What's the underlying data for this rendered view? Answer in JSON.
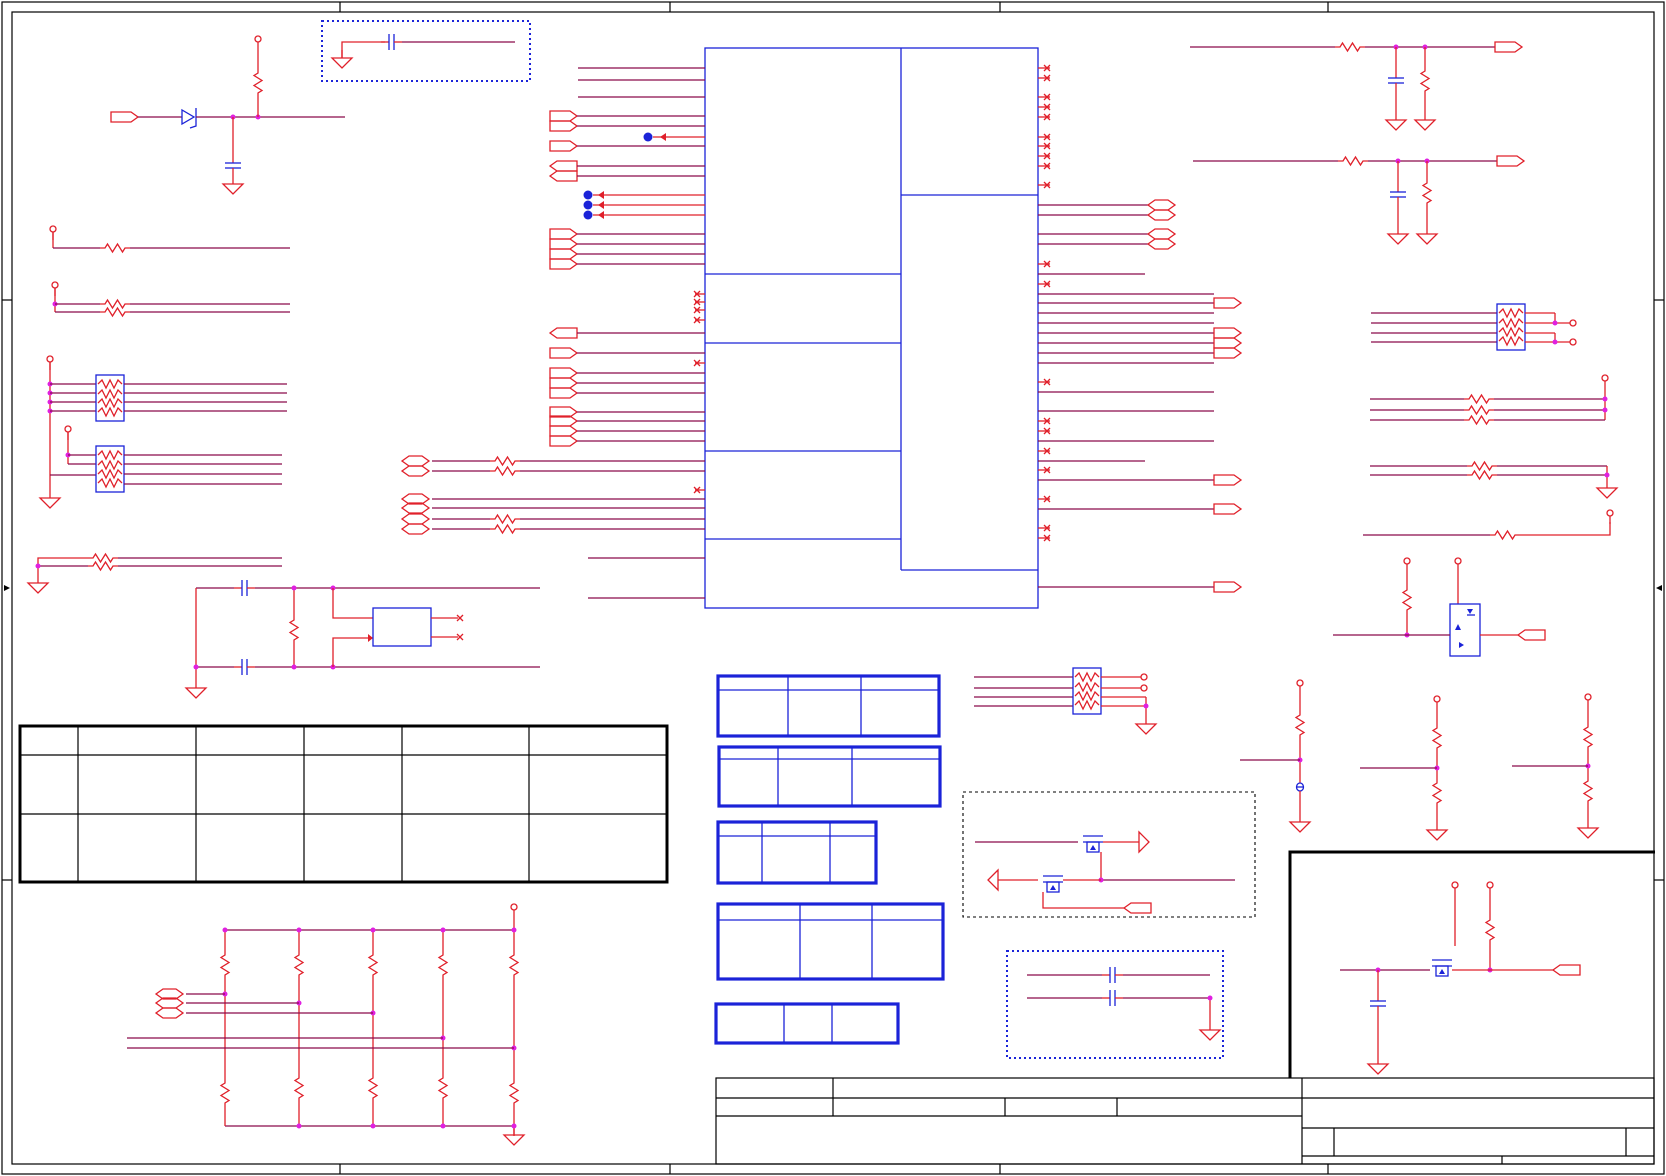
{
  "sheet": {
    "title": "",
    "border_color": "#000000",
    "wire_color": "#8b0a4a",
    "part_color": "#e0202a",
    "ic_color": "#1b23d8",
    "junction_color": "#e020e0"
  }
}
